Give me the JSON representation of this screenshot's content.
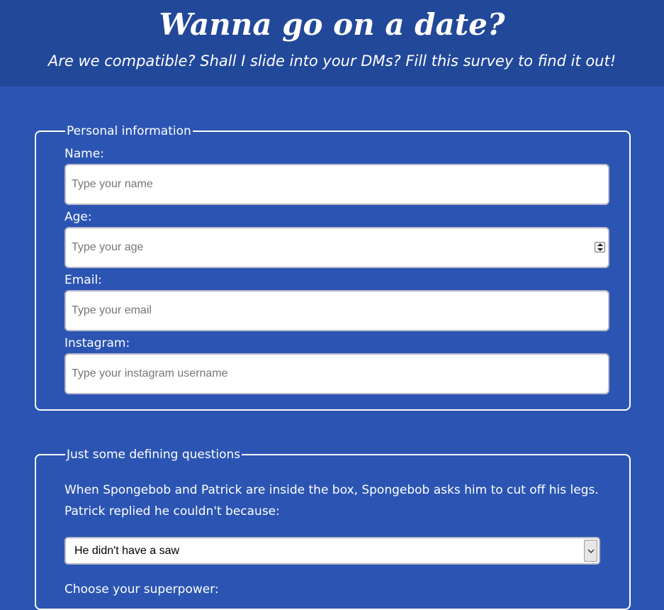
{
  "header": {
    "title": "Wanna go on a date?",
    "subtitle": "Are we compatible? Shall I slide into your DMs? Fill this survey to find it out!"
  },
  "personal": {
    "legend": "Personal information",
    "name_label": "Name:",
    "name_placeholder": "Type your name",
    "age_label": "Age:",
    "age_placeholder": "Type your age",
    "email_label": "Email:",
    "email_placeholder": "Type your email",
    "instagram_label": "Instagram:",
    "instagram_placeholder": "Type your instagram username"
  },
  "questions": {
    "legend": "Just some defining questions",
    "spongebob_question": "When Spongebob and Patrick are inside the box, Spongebob asks him to cut off his legs. Patrick replied he couldn't because:",
    "spongebob_selected": "He didn't have a saw",
    "superpower_label": "Choose your superpower:"
  },
  "colors": {
    "page_background": "#2c55b3",
    "header_background": "#22489a",
    "text": "#ffffff",
    "placeholder_text": "#767676"
  }
}
